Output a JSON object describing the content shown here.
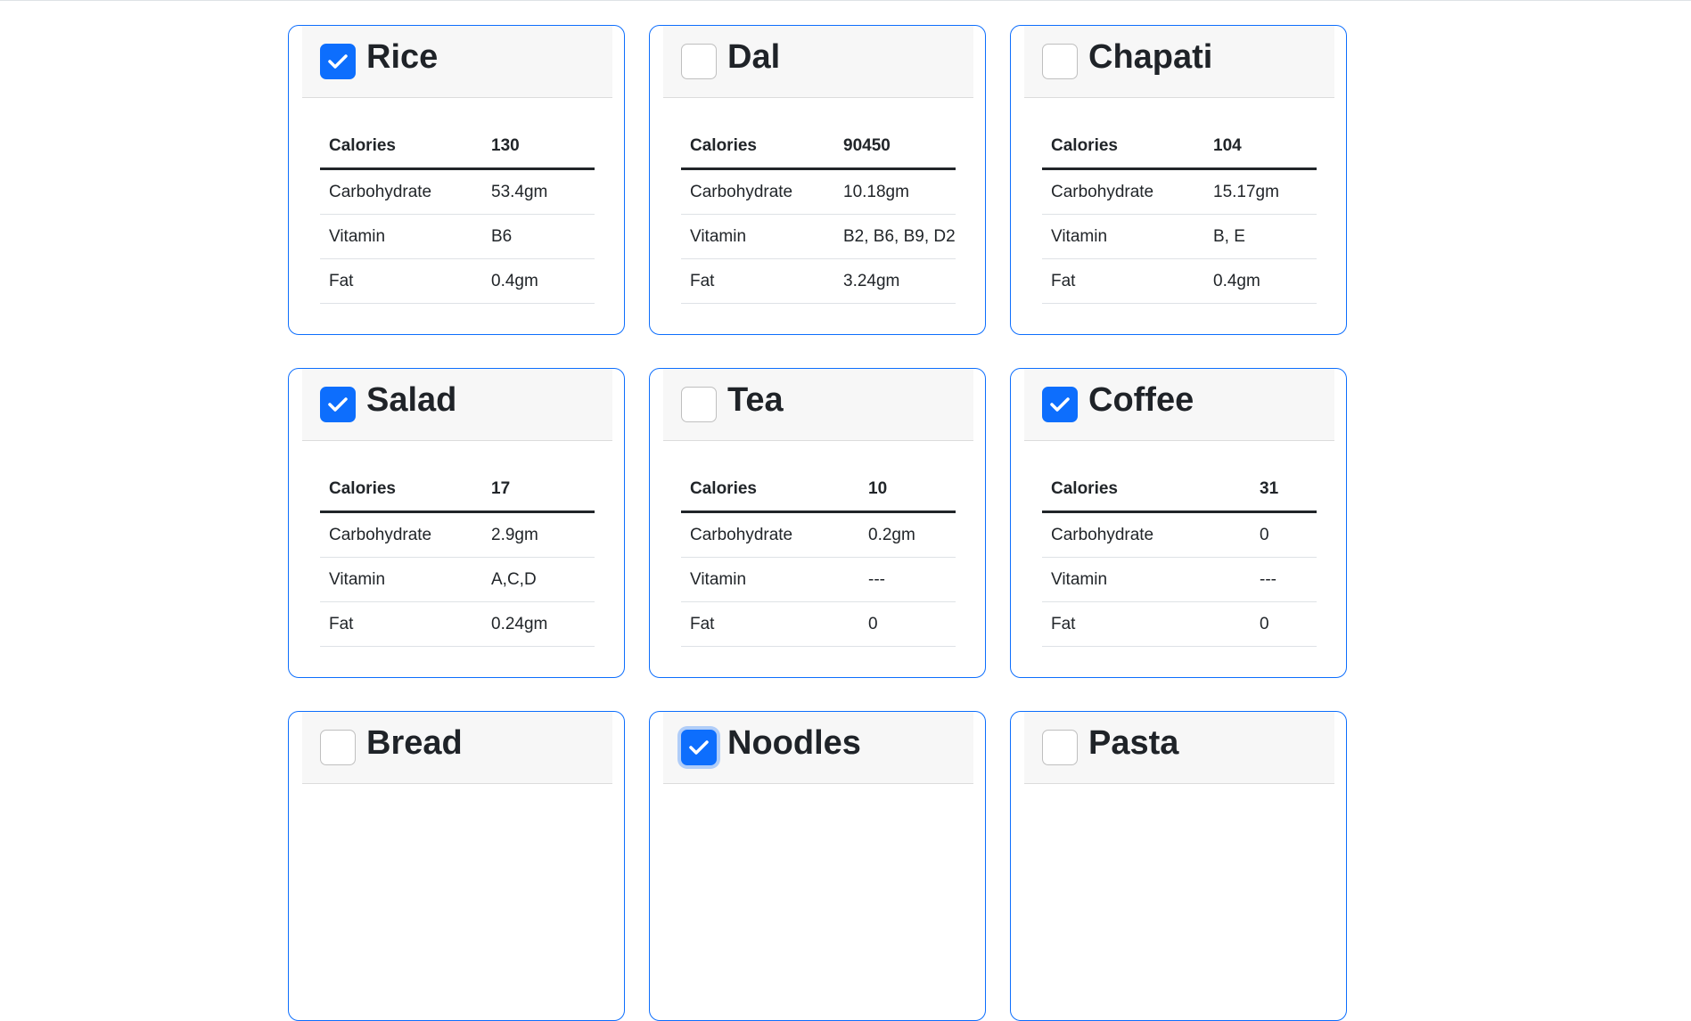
{
  "colors": {
    "accent": "#0d6efd",
    "border": "#0d6efd",
    "header_bg": "#f7f7f7"
  },
  "foods": [
    {
      "name": "Rice",
      "checked": true,
      "focused": false,
      "calories_label": "Calories",
      "calories": "130",
      "rows": [
        {
          "label": "Carbohydrate",
          "value": "53.4gm"
        },
        {
          "label": "Vitamin",
          "value": "B6"
        },
        {
          "label": "Fat",
          "value": "0.4gm"
        }
      ]
    },
    {
      "name": "Dal",
      "checked": false,
      "focused": false,
      "calories_label": "Calories",
      "calories": "90450",
      "rows": [
        {
          "label": "Carbohydrate",
          "value": "10.18gm"
        },
        {
          "label": "Vitamin",
          "value": "B2, B6, B9, D2"
        },
        {
          "label": "Fat",
          "value": "3.24gm"
        }
      ]
    },
    {
      "name": "Chapati",
      "checked": false,
      "focused": false,
      "calories_label": "Calories",
      "calories": "104",
      "rows": [
        {
          "label": "Carbohydrate",
          "value": "15.17gm"
        },
        {
          "label": "Vitamin",
          "value": "B, E"
        },
        {
          "label": "Fat",
          "value": "0.4gm"
        }
      ]
    },
    {
      "name": "Salad",
      "checked": true,
      "focused": false,
      "calories_label": "Calories",
      "calories": "17",
      "rows": [
        {
          "label": "Carbohydrate",
          "value": "2.9gm"
        },
        {
          "label": "Vitamin",
          "value": "A,C,D"
        },
        {
          "label": "Fat",
          "value": "0.24gm"
        }
      ]
    },
    {
      "name": "Tea",
      "checked": false,
      "focused": false,
      "calories_label": "Calories",
      "calories": "10",
      "rows": [
        {
          "label": "Carbohydrate",
          "value": "0.2gm"
        },
        {
          "label": "Vitamin",
          "value": "---"
        },
        {
          "label": "Fat",
          "value": "0"
        }
      ]
    },
    {
      "name": "Coffee",
      "checked": true,
      "focused": false,
      "calories_label": "Calories",
      "calories": "31",
      "rows": [
        {
          "label": "Carbohydrate",
          "value": "0"
        },
        {
          "label": "Vitamin",
          "value": "---"
        },
        {
          "label": "Fat",
          "value": "0"
        }
      ]
    },
    {
      "name": "Bread",
      "checked": false,
      "focused": false
    },
    {
      "name": "Noodles",
      "checked": true,
      "focused": true
    },
    {
      "name": "Pasta",
      "checked": false,
      "focused": false
    }
  ]
}
